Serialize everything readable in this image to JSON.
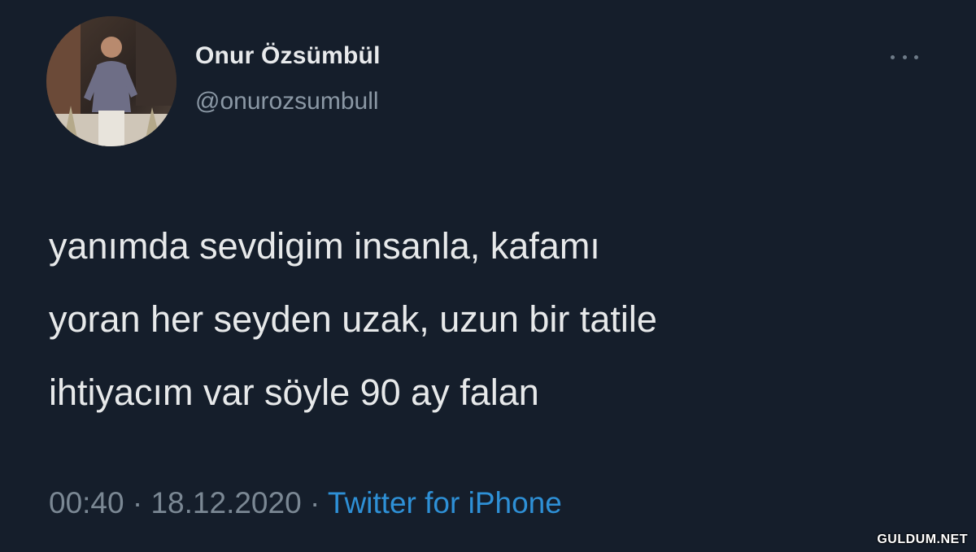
{
  "tweet": {
    "author": {
      "display_name": "Onur Özsümbül",
      "handle": "@onurozsumbull",
      "avatar_icon": "profile-photo-avatar"
    },
    "more_icon": "more-options-icon",
    "text_lines": [
      "yanımda sevdigim insanla, kafamı",
      "yoran her seyden uzak, uzun bir tatile",
      "ihtiyacım var söyle 90 ay falan"
    ],
    "time": "00:40",
    "separator": "·",
    "date": "18.12.2020",
    "source": "Twitter for iPhone"
  },
  "watermark": "GULDUM.NET",
  "colors": {
    "background": "#151e2b",
    "text": "#e7e9ea",
    "secondary": "#8b98a5",
    "link": "#2e90d6"
  }
}
